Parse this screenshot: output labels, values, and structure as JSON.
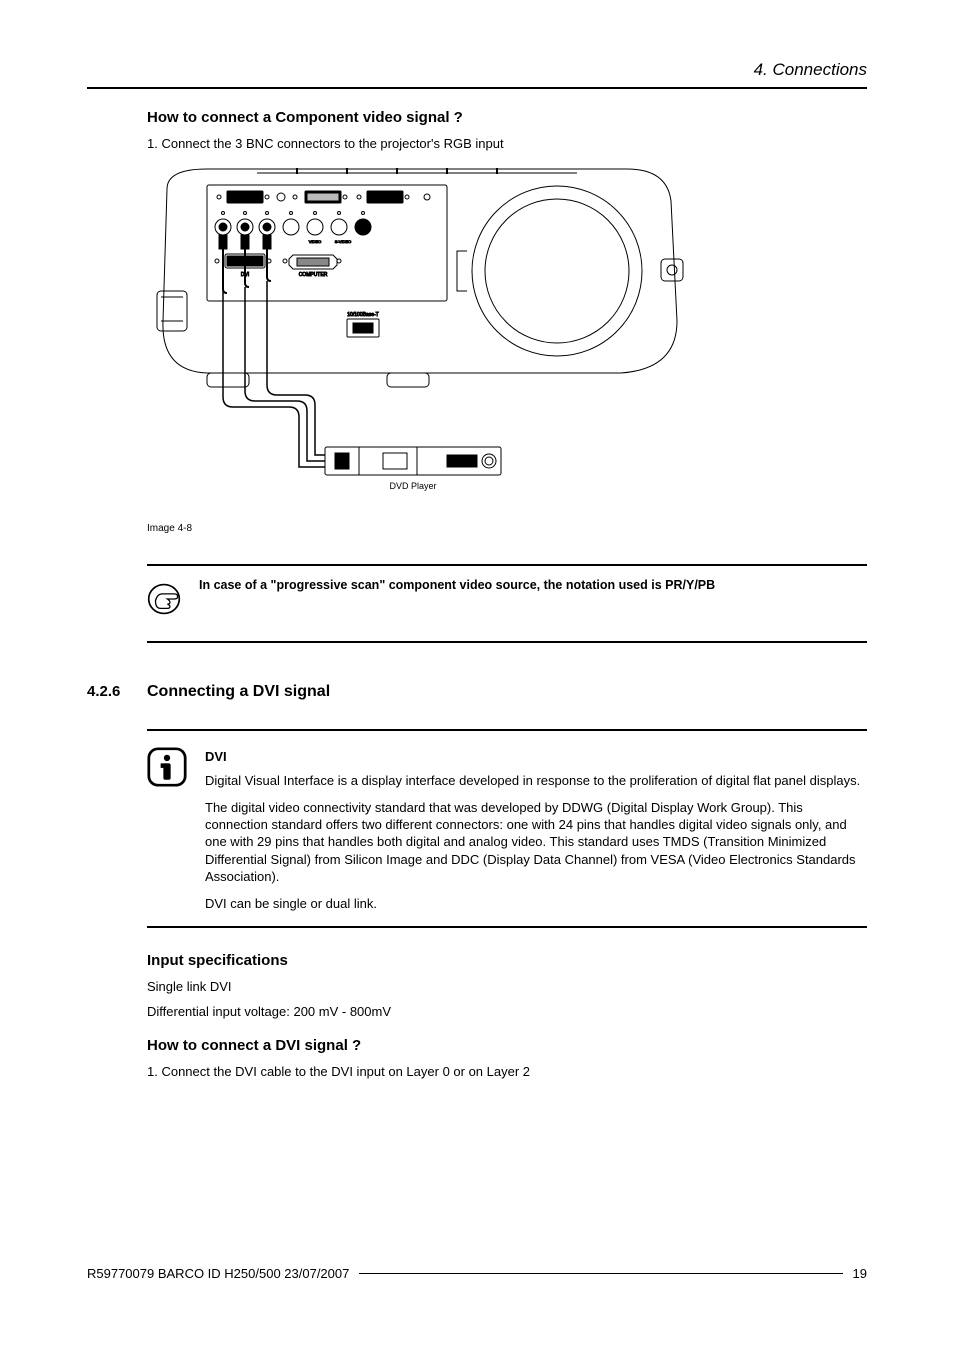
{
  "header": {
    "chapter": "4.  Connections"
  },
  "s1": {
    "heading": "How to connect a Component video signal ?",
    "step1": "1.  Connect the 3 BNC connectors to the projector's RGB input",
    "img_caption": "Image 4-8",
    "note": "In case of a \"progressive scan\" component video source, the notation used is PR/Y/PB",
    "svg_labels": {
      "dvda": "DVD Player",
      "port_panel": "",
      "dvi": "DVI",
      "computer": "COMPUTER",
      "video": "VIDEO",
      "svideo": "S-VIDEO",
      "modline": "10/100Base-T"
    }
  },
  "s2": {
    "num": "4.2.6",
    "title": "Connecting a DVI signal",
    "term": "DVI",
    "p1": "Digital Visual Interface is a display interface developed in response to the proliferation of digital flat panel displays.",
    "p2": "The digital video connectivity standard that was developed by DDWG (Digital Display Work Group).  This connection standard offers two different connectors:  one with 24 pins that handles digital video signals only, and one with 29 pins that handles both digital and analog video.  This standard uses TMDS (Transition Minimized Differential Signal) from Silicon Image and DDC (Display Data Channel) from VESA (Video Electronics Standards Association).",
    "p3": "DVI can be single or dual link.",
    "h_input": "Input specifications",
    "spec1": "Single link DVI",
    "spec2": "Differential input voltage:  200 mV - 800mV",
    "h_how": "How to connect a DVI signal ?",
    "how_step1": "1.  Connect the DVI cable to the DVI input on Layer 0 or on Layer 2"
  },
  "footer": {
    "doc": "R59770079  BARCO ID H250/500  23/07/2007",
    "page": "19"
  }
}
